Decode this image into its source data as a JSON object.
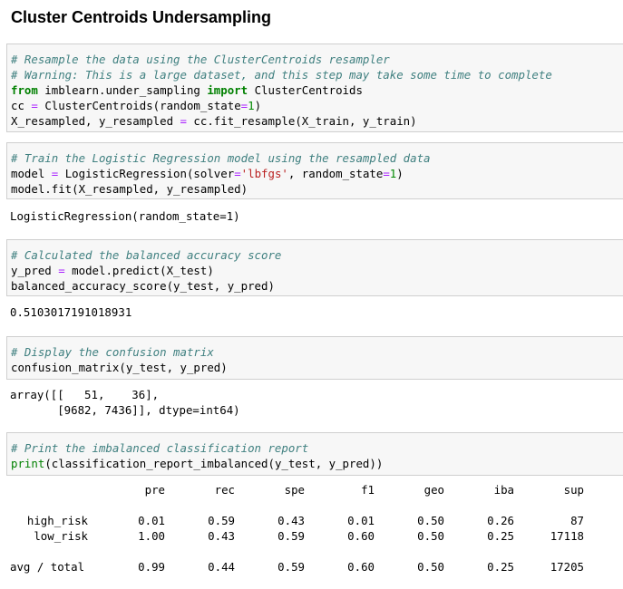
{
  "page": {
    "title": "Cluster Centroids Undersampling"
  },
  "cells": {
    "c1": {
      "comment1": "# Resample the data using the ClusterCentroids resampler",
      "comment2": "# Warning: This is a large dataset, and this step may take some time to complete",
      "kw_from": "from",
      "module": " imblearn.under_sampling ",
      "kw_import": "import",
      "imported": " ClusterCentroids",
      "l4a": "cc ",
      "l4op": "=",
      "l4b": " ClusterCentroids(random_state",
      "l4op2": "=",
      "l4num": "1",
      "l4c": ")",
      "l5a": "X_resampled, y_resampled ",
      "l5op": "=",
      "l5b": " cc.fit_resample(X_train, y_train)"
    },
    "c2": {
      "comment": "# Train the Logistic Regression model using the resampled data",
      "l2a": "model ",
      "l2op": "=",
      "l2b": " LogisticRegression(solver",
      "l2op2": "=",
      "l2str": "'lbfgs'",
      "l2c": ", random_state",
      "l2op3": "=",
      "l2num": "1",
      "l2d": ")",
      "l3": "model.fit(X_resampled, y_resampled)",
      "output": "LogisticRegression(random_state=1)"
    },
    "c3": {
      "comment": "# Calculated the balanced accuracy score",
      "l2a": "y_pred ",
      "l2op": "=",
      "l2b": " model.predict(X_test)",
      "l3": "balanced_accuracy_score(y_test, y_pred)",
      "output": "0.5103017191018931"
    },
    "c4": {
      "comment": "# Display the confusion matrix",
      "l2": "confusion_matrix(y_test, y_pred)",
      "output1": "array([[   51,    36],",
      "output2": "       [9682, 7436]], dtype=int64)"
    },
    "c5": {
      "comment": "# Print the imbalanced classification report",
      "print_kw": "print",
      "l2rest": "(classification_report_imbalanced(y_test, y_pred))"
    }
  },
  "report": {
    "headers": [
      "pre",
      "rec",
      "spe",
      "f1",
      "geo",
      "iba",
      "sup"
    ],
    "rows": [
      {
        "label": "high_risk",
        "values": [
          "0.01",
          "0.59",
          "0.43",
          "0.01",
          "0.50",
          "0.26",
          "87"
        ]
      },
      {
        "label": "low_risk",
        "values": [
          "1.00",
          "0.43",
          "0.59",
          "0.60",
          "0.50",
          "0.25",
          "17118"
        ]
      },
      {
        "label": "avg / total",
        "values": [
          "0.99",
          "0.44",
          "0.59",
          "0.60",
          "0.50",
          "0.25",
          "17205"
        ]
      }
    ]
  }
}
